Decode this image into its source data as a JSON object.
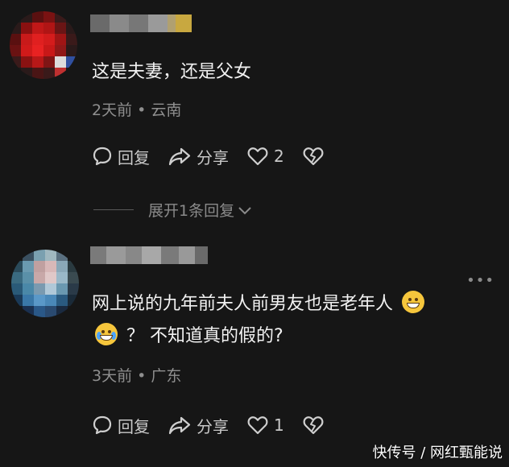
{
  "comments": [
    {
      "text": "这是夫妻，还是父女",
      "time": "2天前",
      "location": "云南",
      "reply_label": "回复",
      "share_label": "分享",
      "like_count": "2",
      "expand_label": "展开1条回复"
    },
    {
      "text_a": "网上说的九年前夫人前男友也是老年人",
      "text_b": "？ 不知道真的假的?",
      "time": "3天前",
      "location": "广东",
      "reply_label": "回复",
      "share_label": "分享",
      "like_count": "1"
    }
  ],
  "watermark": "快传号 / 网红甄能说",
  "icons": {
    "reply": "comment-bubble-icon",
    "share": "share-arrow-icon",
    "like": "heart-outline-icon",
    "dislike": "broken-heart-icon",
    "more": "more-dots-icon",
    "expand": "chevron-down-icon"
  }
}
